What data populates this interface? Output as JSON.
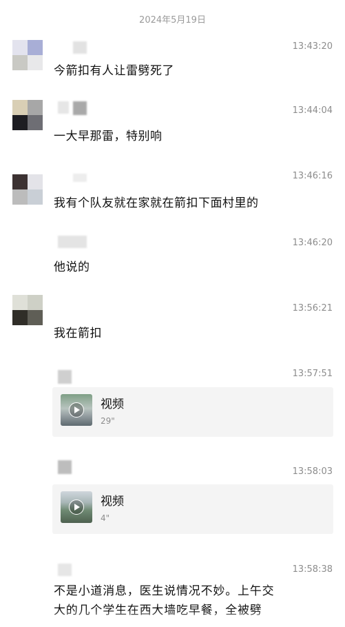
{
  "date": "2024年5月19日",
  "messages": [
    {
      "time": "13:43:20",
      "text": "今箭扣有人让雷劈死了"
    },
    {
      "time": "13:44:04",
      "text": "一大早那雷，特别响"
    },
    {
      "time": "13:46:16",
      "text": "我有个队友就在家就在箭扣下面村里的"
    },
    {
      "time": "13:46:20",
      "text": "他说的"
    },
    {
      "time": "13:56:21",
      "text": "我在箭扣"
    },
    {
      "time": "13:57:51",
      "video": {
        "label": "视频",
        "duration": "29\""
      }
    },
    {
      "time": "13:58:03",
      "video": {
        "label": "视频",
        "duration": "4\""
      }
    },
    {
      "time": "13:58:38",
      "text_lines": [
        "不是小道消息，医生说情况不妙。上午交",
        "大的几个学生在西大墙吃早餐，全被劈"
      ]
    }
  ]
}
